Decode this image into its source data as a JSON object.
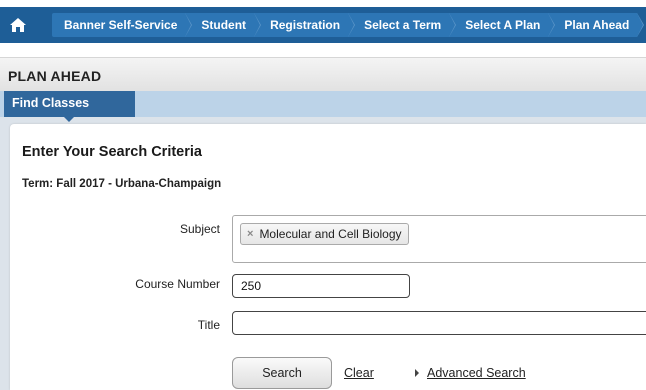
{
  "nav": {
    "home_icon": "home-icon",
    "breadcrumbs": [
      "Banner Self-Service",
      "Student",
      "Registration",
      "Select a Term",
      "Select A Plan",
      "Plan Ahead"
    ]
  },
  "page": {
    "title": "PLAN AHEAD"
  },
  "tabs": [
    {
      "label": "Find Classes",
      "active": true
    }
  ],
  "search": {
    "heading": "Enter Your Search Criteria",
    "term": "Term: Fall 2017 - Urbana-Champaign",
    "subject_label": "Subject",
    "subject_tokens": [
      "Molecular and Cell Biology"
    ],
    "token_remove": "×",
    "course_label": "Course Number",
    "course_value": "250",
    "title_label": "Title",
    "title_value": "",
    "search_button": "Search",
    "clear_link": "Clear",
    "advanced_link": "Advanced Search"
  },
  "colors": {
    "nav_bar": "#1e5e97",
    "crumb": "#2d76b5",
    "tab_active": "#30679c",
    "tab_row": "#bcd3e8"
  }
}
